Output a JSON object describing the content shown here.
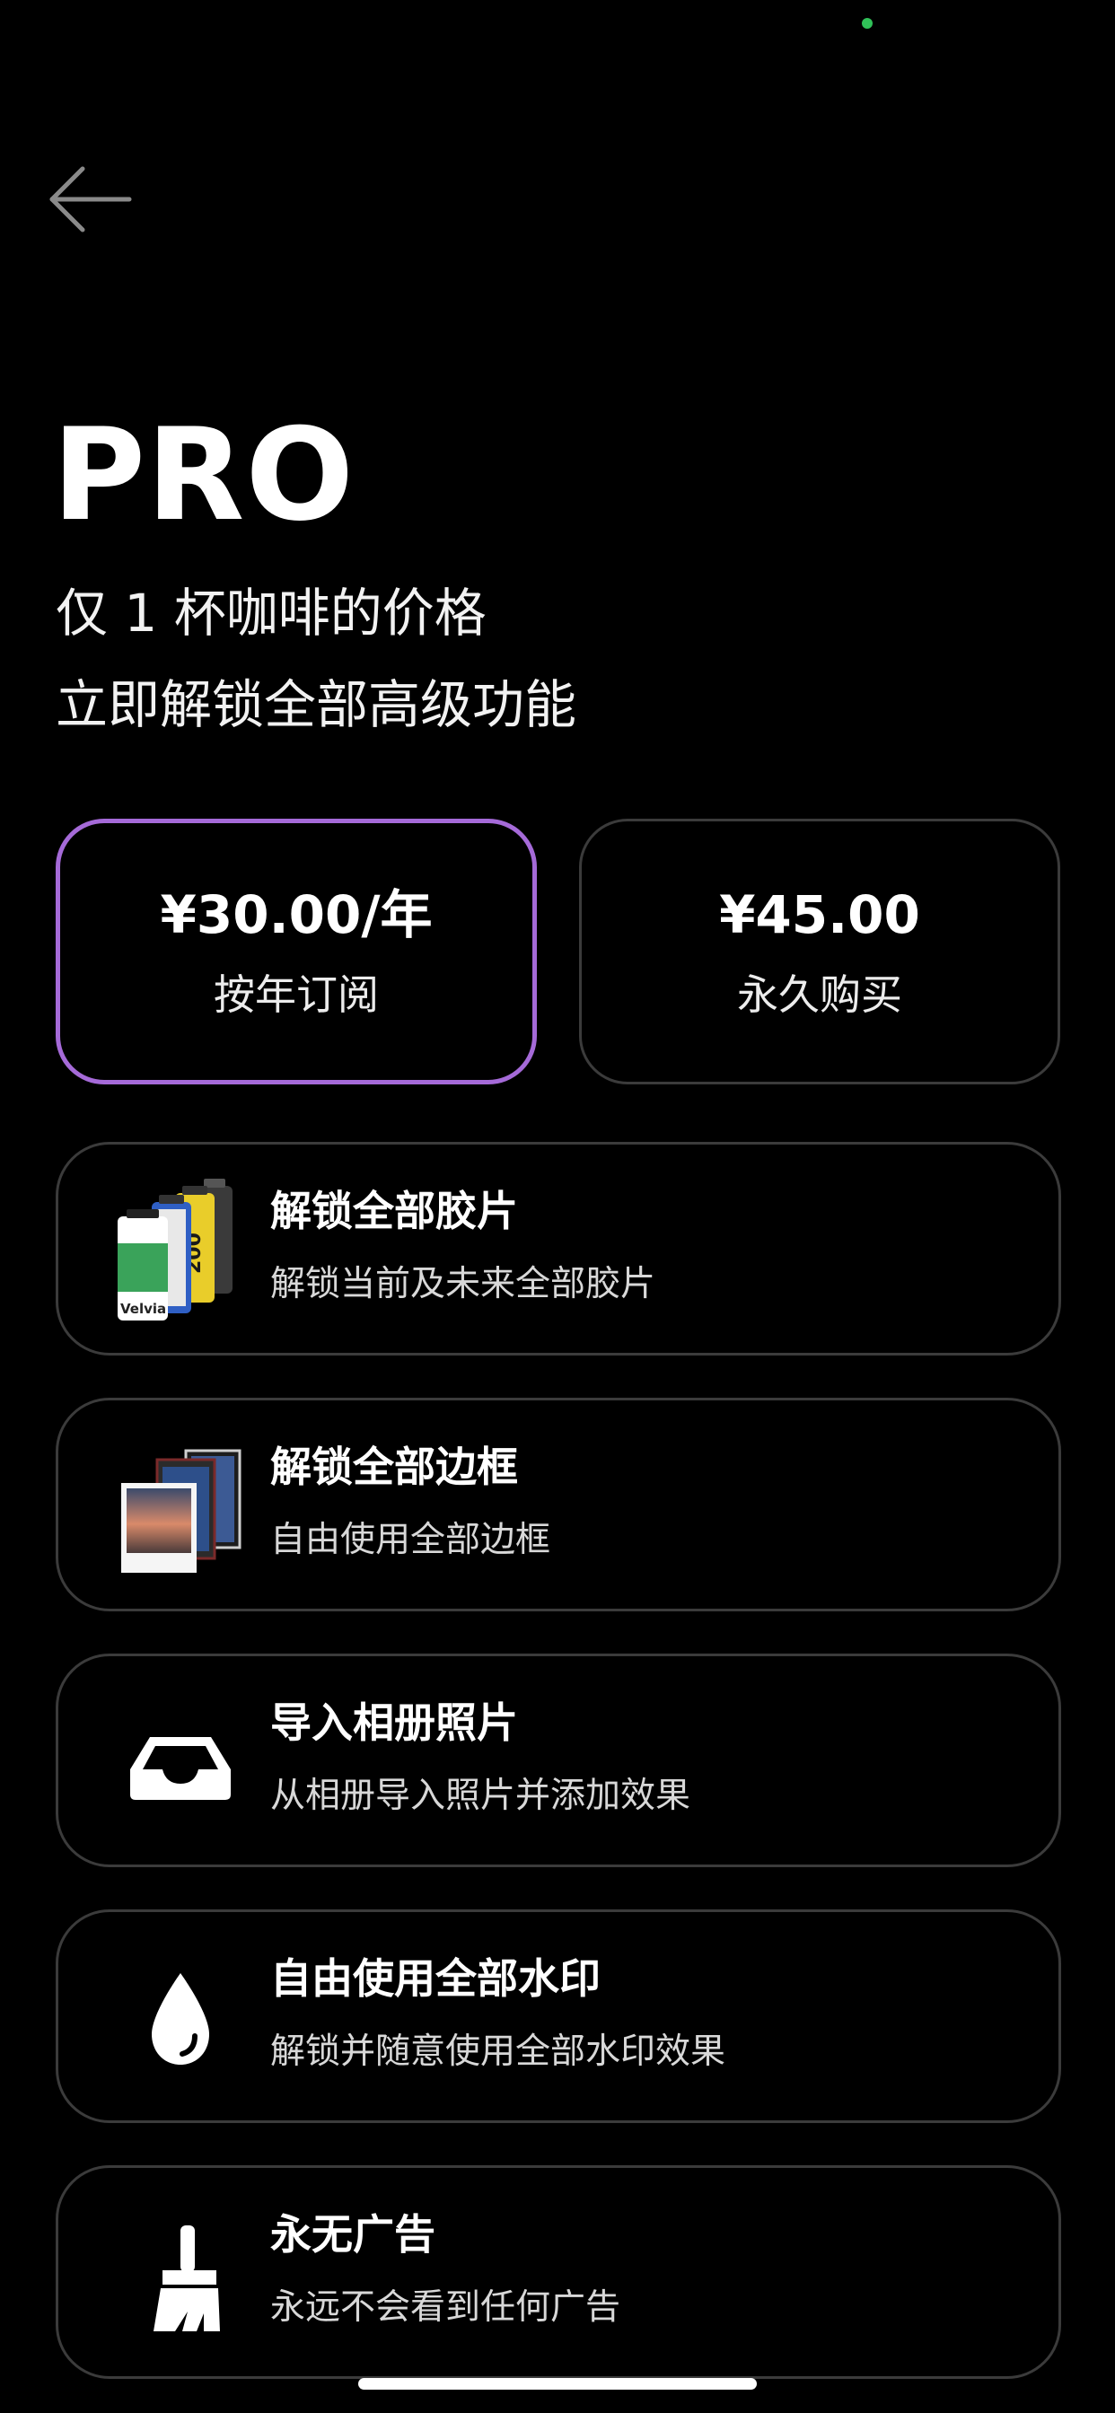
{
  "header": {
    "back_label": "Back",
    "title": "PRO",
    "subtitle_line1": "仅 1 杯咖啡的价格",
    "subtitle_line2": "立即解锁全部高级功能"
  },
  "plans": [
    {
      "price": "¥30.00/年",
      "label": "按年订阅",
      "selected": true
    },
    {
      "price": "¥45.00",
      "label": "永久购买",
      "selected": false
    }
  ],
  "features": [
    {
      "icon": "film-canisters-icon",
      "title": "解锁全部胶片",
      "desc": "解锁当前及未来全部胶片"
    },
    {
      "icon": "photo-frames-icon",
      "title": "解锁全部边框",
      "desc": "自由使用全部边框"
    },
    {
      "icon": "inbox-tray-icon",
      "title": "导入相册照片",
      "desc": "从相册导入照片并添加效果"
    },
    {
      "icon": "water-drop-icon",
      "title": "自由使用全部水印",
      "desc": "解锁并随意使用全部水印效果"
    },
    {
      "icon": "broom-icon",
      "title": "永无广告",
      "desc": "永远不会看到任何广告"
    }
  ],
  "colors": {
    "background": "#000000",
    "selected_border": "#a56ad8",
    "card_border": "#3b3b3b",
    "status_dot": "#30c158"
  }
}
